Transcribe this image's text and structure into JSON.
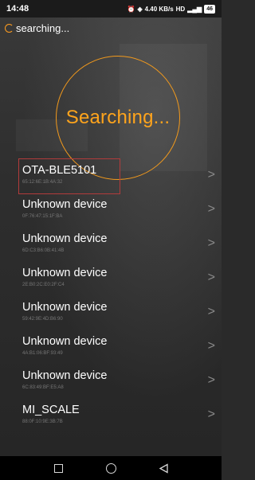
{
  "status_bar": {
    "time": "14:48",
    "icons": [
      "alarm-icon",
      "vibrate-icon",
      "speed-icon",
      "hd-icon",
      "signal-icon"
    ],
    "speed": "4.40 KB/s",
    "battery": "46"
  },
  "header": {
    "status": "searching..."
  },
  "scan": {
    "label": "Searching..."
  },
  "devices": [
    {
      "name": "OTA-BLE5101",
      "mac": "65:12:6E:1B:4A:32"
    },
    {
      "name": "Unknown device",
      "mac": "0F:76:47:15:1F:BA"
    },
    {
      "name": "Unknown device",
      "mac": "6D:C3:B6:0B:41:4B"
    },
    {
      "name": "Unknown device",
      "mac": "2E:B0:2C:E0:2F:C4"
    },
    {
      "name": "Unknown device",
      "mac": "59:42:9E:4D:B6:90"
    },
    {
      "name": "Unknown device",
      "mac": "4A:B1:06:BF:93:49"
    },
    {
      "name": "Unknown device",
      "mac": "6C:83:49:BF:E5:A8"
    },
    {
      "name": "MI_SCALE",
      "mac": "88:0F:10:9E:3B:7B"
    }
  ],
  "colors": {
    "accent": "#ffa41c",
    "highlight": "#b23b3b"
  }
}
